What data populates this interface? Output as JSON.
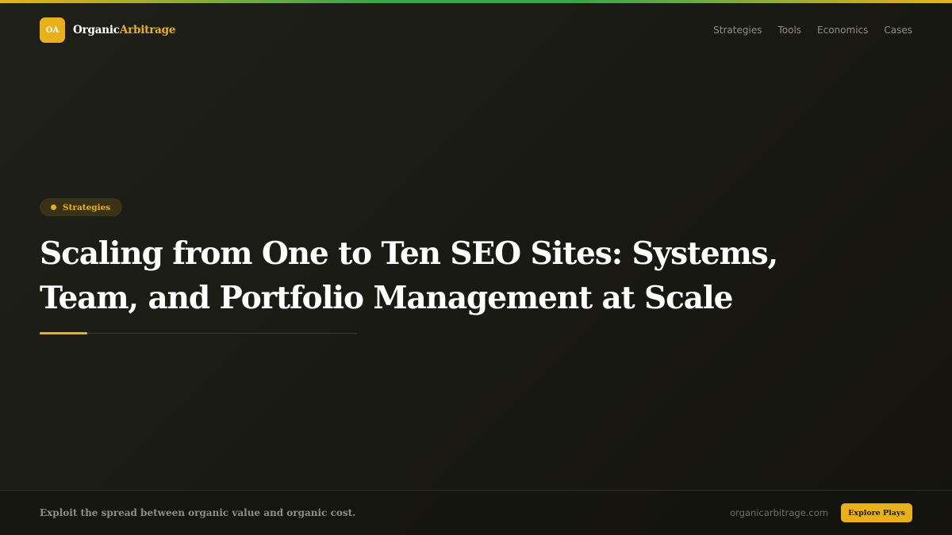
{
  "header": {
    "logo_text": "OA",
    "brand_primary": "Organic",
    "brand_accent": "Arbitrage",
    "nav": [
      "Strategies",
      "Tools",
      "Economics",
      "Cases"
    ]
  },
  "article": {
    "category": "Strategies",
    "title": "Scaling from One to Ten SEO Sites: Systems, Team, and Portfolio Management at Scale"
  },
  "footer": {
    "tagline": "Exploit the spread between organic value and organic cost.",
    "domain": "organicarbitrage.com",
    "cta_label": "Explore Plays"
  },
  "colors": {
    "accent": "#e9b019",
    "secondary": "#2fa94a",
    "background": "#1a1a14"
  }
}
